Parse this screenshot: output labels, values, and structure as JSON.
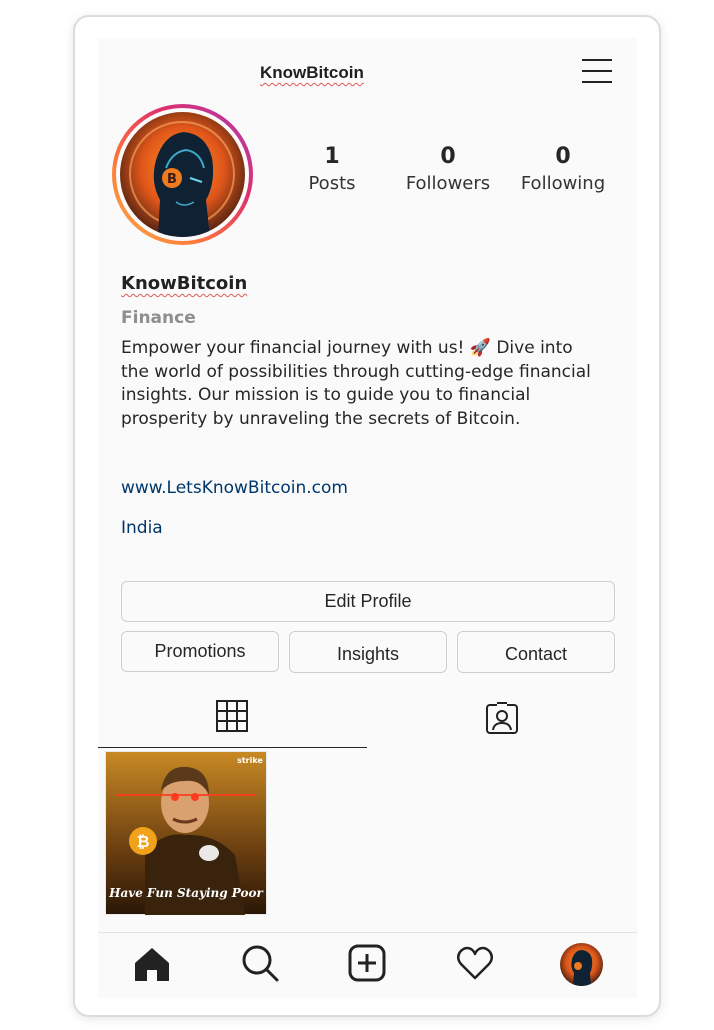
{
  "header": {
    "username": "KnowBitcoin"
  },
  "stats": [
    {
      "count": "1",
      "label": "Posts"
    },
    {
      "count": "0",
      "label": "Followers"
    },
    {
      "count": "0",
      "label": "Following"
    }
  ],
  "profile": {
    "name": "KnowBitcoin",
    "category": "Finance",
    "bio": "Empower your financial journey with us! 🚀 Dive into the world of possibilities through cutting-edge financial insights. Our mission is to guide you to financial prosperity by unraveling the secrets of Bitcoin.",
    "website": "www.LetsKnowBitcoin.com",
    "location": "India"
  },
  "buttons": {
    "edit_profile": "Edit Profile",
    "promotions": "Promotions",
    "insights": "Insights",
    "contact": "Contact"
  },
  "tabs": [
    "grid-icon",
    "tagged-icon"
  ],
  "posts": [
    {
      "caption": "Have Fun Staying Poor",
      "watermark": "strike"
    }
  ],
  "bottom_nav": [
    "home-icon",
    "search-icon",
    "create-icon",
    "heart-icon",
    "profile-avatar"
  ],
  "colors": {
    "link": "#00376b",
    "ring_gradient": [
      "#fcb045",
      "#e1306c",
      "#a83ab4"
    ],
    "category": "#8e8e8e"
  }
}
